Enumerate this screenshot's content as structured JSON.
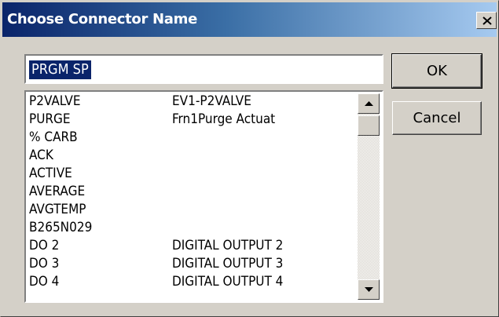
{
  "window": {
    "title": "Choose Connector Name",
    "close_icon": "close-icon"
  },
  "name_field": {
    "value": "PRGM SP"
  },
  "buttons": {
    "ok": "OK",
    "cancel": "Cancel"
  },
  "list": {
    "rows": [
      {
        "name": " P2VALVE",
        "description": "EV1-P2VALVE"
      },
      {
        "name": " PURGE",
        "description": "Frn1Purge Actuat"
      },
      {
        "name": "% CARB",
        "description": ""
      },
      {
        "name": "ACK",
        "description": ""
      },
      {
        "name": "ACTIVE",
        "description": ""
      },
      {
        "name": "AVERAGE",
        "description": ""
      },
      {
        "name": "AVGTEMP",
        "description": ""
      },
      {
        "name": "B265N029",
        "description": ""
      },
      {
        "name": "DO 2",
        "description": "DIGITAL OUTPUT 2"
      },
      {
        "name": "DO 3",
        "description": "DIGITAL OUTPUT 3"
      },
      {
        "name": "DO 4",
        "description": "DIGITAL OUTPUT 4"
      }
    ],
    "scroll_position": 0.0
  },
  "colors": {
    "dialog_bg": "#d4d0c8",
    "title_gradient_start": "#0a246a",
    "title_gradient_end": "#a6caf0",
    "selection_bg": "#0a246a"
  }
}
